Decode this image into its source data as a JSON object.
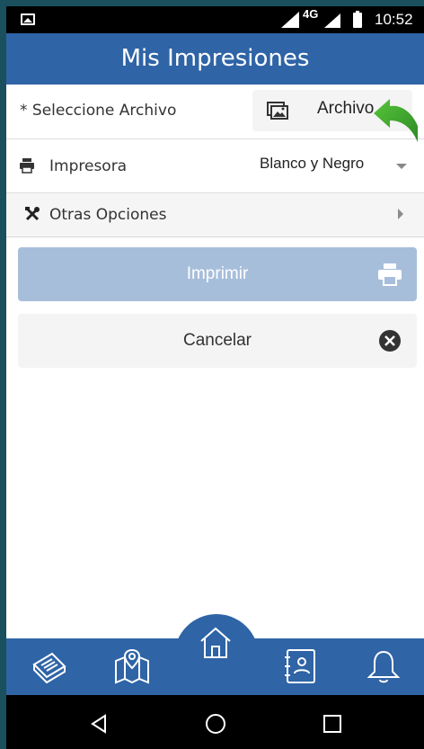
{
  "status_bar": {
    "network": "4G",
    "time": "10:52"
  },
  "header": {
    "title": "Mis Impresiones"
  },
  "file_row": {
    "label": "* Seleccione Archivo",
    "button_label": "Archivo",
    "icon": "picture-icon"
  },
  "printer_row": {
    "label": "Impresora",
    "selected": "Blanco y Negro",
    "icon": "printer-icon"
  },
  "options_row": {
    "label": "Otras Opciones",
    "icon": "tools-icon"
  },
  "buttons": {
    "print_label": "Imprimir",
    "cancel_label": "Cancelar"
  },
  "bottom_nav": {
    "items": [
      "news-icon",
      "map-icon",
      "home-icon",
      "contacts-icon",
      "bell-icon"
    ]
  },
  "colors": {
    "primary": "#2f64a6",
    "print_button": "#a7bedb",
    "arrow": "#3fae2e"
  }
}
